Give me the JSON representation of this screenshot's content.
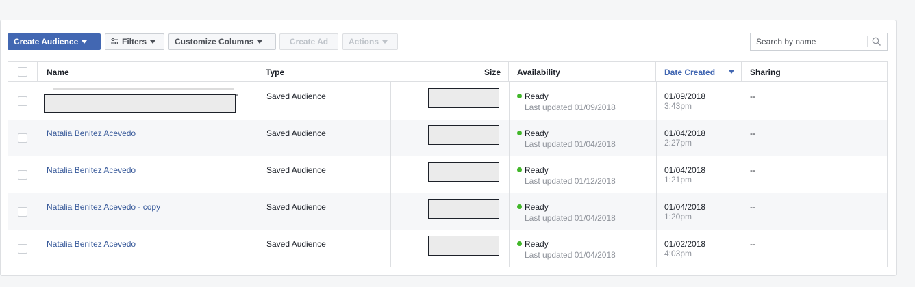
{
  "toolbar": {
    "create_audience": "Create Audience",
    "filters": "Filters",
    "customize_columns": "Customize Columns",
    "create_ad": "Create Ad",
    "actions": "Actions"
  },
  "search": {
    "placeholder": "Search by name"
  },
  "columns": {
    "name": "Name",
    "type": "Type",
    "size": "Size",
    "availability": "Availability",
    "date_created": "Date Created",
    "sharing": "Sharing"
  },
  "rows": [
    {
      "name": "",
      "type": "Saved Audience",
      "status": "Ready",
      "updated": "Last updated 01/09/2018",
      "date": "01/09/2018",
      "time": "3:43pm",
      "sharing": "--"
    },
    {
      "name": "Natalia Benitez Acevedo",
      "type": "Saved Audience",
      "status": "Ready",
      "updated": "Last updated 01/04/2018",
      "date": "01/04/2018",
      "time": "2:27pm",
      "sharing": "--"
    },
    {
      "name": "Natalia Benitez Acevedo",
      "type": "Saved Audience",
      "status": "Ready",
      "updated": "Last updated 01/12/2018",
      "date": "01/04/2018",
      "time": "1:21pm",
      "sharing": "--"
    },
    {
      "name": "Natalia Benitez Acevedo - copy",
      "type": "Saved Audience",
      "status": "Ready",
      "updated": "Last updated 01/04/2018",
      "date": "01/04/2018",
      "time": "1:20pm",
      "sharing": "--"
    },
    {
      "name": "Natalia Benitez Acevedo",
      "type": "Saved Audience",
      "status": "Ready",
      "updated": "Last updated 01/04/2018",
      "date": "01/02/2018",
      "time": "4:03pm",
      "sharing": "--"
    }
  ],
  "redacted_suffix": "-",
  "colors": {
    "primary": "#4267b2",
    "link": "#365899",
    "ready": "#42b72a"
  },
  "icons": {
    "filters": "sliders-icon",
    "search": "magnifier-icon",
    "caret": "caret-down-icon"
  }
}
